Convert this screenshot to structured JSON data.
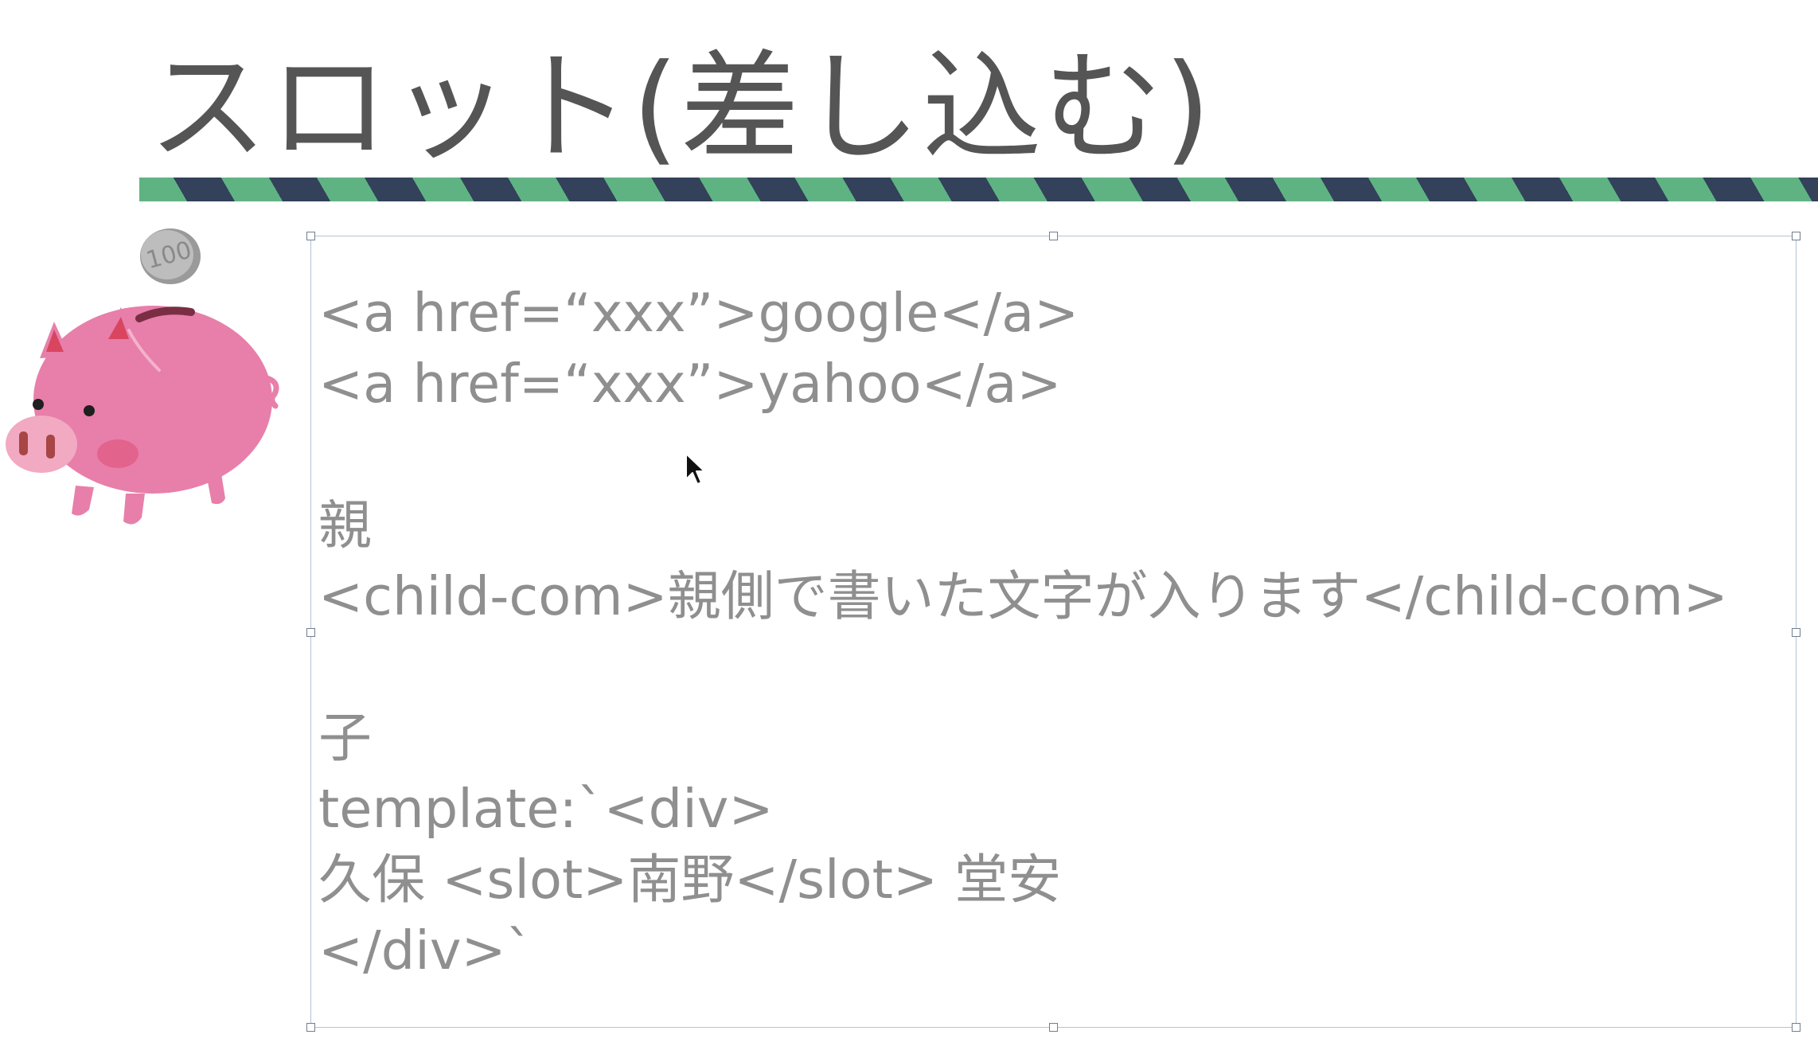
{
  "slide": {
    "title": "スロット(差し込む)"
  },
  "coin": {
    "label": "100"
  },
  "text_box": {
    "lines": [
      "<a href=“xxx”>google</a>",
      "<a href=“xxx”>yahoo</a>",
      "",
      "親",
      "<child-com>親側で書いた文字が入ります</child-com>",
      "",
      "子",
      "template:`<div>",
      "久保 <slot>南野</slot> 堂安",
      "</div>`"
    ]
  },
  "colors": {
    "title": "#555555",
    "stripe_green": "#5fb383",
    "stripe_navy": "#33415a",
    "body_text": "#8f8f8f",
    "box_border": "#b3c3d6",
    "piggy_pink": "#e77faa",
    "coin_gray": "#9a9a9a"
  },
  "icons": {
    "illustration": "piggy-bank-icon",
    "pointer": "mouse-cursor-icon"
  }
}
